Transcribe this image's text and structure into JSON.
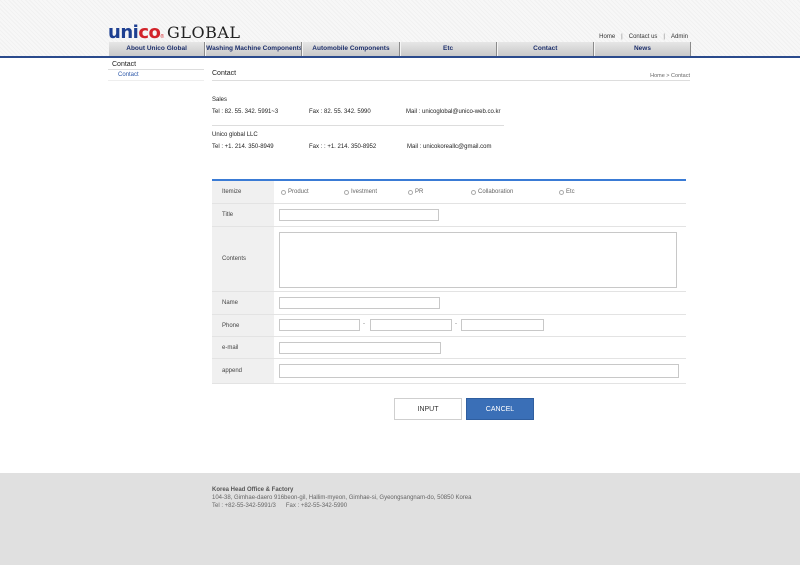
{
  "header": {
    "brand_un": "un",
    "brand_i": "i",
    "brand_co": "co",
    "brand_reg": "®",
    "brand_global": "GLOBAL",
    "top_links": [
      "Home",
      "Contact us",
      "Admin"
    ],
    "separators": "|"
  },
  "nav": [
    "About Unico Global",
    "Washing Machine Components",
    "Automobile Components",
    "Etc",
    "Contact",
    "News"
  ],
  "sidebar": {
    "title": "Contact",
    "items": [
      "Contact"
    ]
  },
  "page": {
    "title": "Contact",
    "breadcrumb": "Home >  Contact"
  },
  "sales": {
    "heading": "Sales",
    "tel": "Tel : 82. 55. 342. 5991~3",
    "fax": "Fax : 82. 55. 342. 5990",
    "mail": "Mail : unicoglobal@unico-web.co.kr"
  },
  "llc": {
    "heading": "Unico global LLC",
    "tel": "Tel : +1. 214. 350-8949",
    "fax": "Fax : : +1. 214. 350-8952",
    "mail": "Mail : unicokoreallc@gmail.com"
  },
  "form": {
    "itemize_label": "Itemize",
    "itemize_options": [
      "Product",
      "Ivestment",
      "PR",
      "Collaboration",
      "Etc"
    ],
    "title_label": "Title",
    "contents_label": "Contents",
    "name_label": "Name",
    "phone_label": "Phone",
    "phone_dash": "-",
    "email_label": "e-mail",
    "append_label": " append"
  },
  "buttons": {
    "input": "INPUT",
    "cancel": "CANCEL"
  },
  "footer": {
    "line1": "Korea Head Office & Factory",
    "line2": "104-38, Gimhae-daero 916beon-gil, Hallim-myeon, Gimhae-si, Gyeongsangnam-do, 50850 Korea",
    "line3": "Tel : +82-55-342-5991/3      Fax : +82-55-342-5990"
  },
  "colors": {
    "brand_blue": "#1d3f91",
    "brand_red": "#d2232a",
    "accent": "#3a6fb7"
  }
}
